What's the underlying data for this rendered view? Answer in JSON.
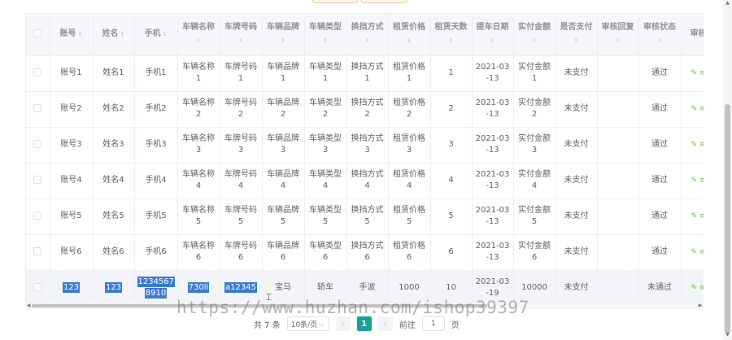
{
  "table": {
    "headers": {
      "account": "账号",
      "name": "姓名",
      "phone": "手机",
      "vehicle_name": "车辆名称",
      "plate": "车牌号码",
      "brand": "车辆品牌",
      "vehicle_type": "车辆类型",
      "gear": "换挡方式",
      "price": "租赁价格",
      "days": "租赁天数",
      "pickup_date": "提车日期",
      "paid_amount": "实付金额",
      "is_paid": "是否支付",
      "review_reply": "审核回复",
      "review_status": "审核状态",
      "review_op": "审核"
    },
    "rows": [
      {
        "account": "账号1",
        "name": "姓名1",
        "phone": "手机1",
        "vehicle_name": [
          "车辆名称",
          "1"
        ],
        "plate": [
          "车牌号码",
          "1"
        ],
        "brand": [
          "车辆品牌",
          "1"
        ],
        "vehicle_type": [
          "车辆类型",
          "1"
        ],
        "gear": [
          "换挡方式",
          "1"
        ],
        "price": [
          "租赁价格",
          "1"
        ],
        "days": "1",
        "pickup_date": [
          "2021-03",
          "-13"
        ],
        "paid_amount": [
          "实付金额",
          "1"
        ],
        "is_paid": "未支付",
        "review_reply": "",
        "review_status": "通过"
      },
      {
        "account": "账号2",
        "name": "姓名2",
        "phone": "手机2",
        "vehicle_name": [
          "车辆名称",
          "2"
        ],
        "plate": [
          "车牌号码",
          "2"
        ],
        "brand": [
          "车辆品牌",
          "2"
        ],
        "vehicle_type": [
          "车辆类型",
          "2"
        ],
        "gear": [
          "换挡方式",
          "2"
        ],
        "price": [
          "租赁价格",
          "2"
        ],
        "days": "2",
        "pickup_date": [
          "2021-03",
          "-13"
        ],
        "paid_amount": [
          "实付金额",
          "2"
        ],
        "is_paid": "未支付",
        "review_reply": "",
        "review_status": "通过"
      },
      {
        "account": "账号3",
        "name": "姓名3",
        "phone": "手机3",
        "vehicle_name": [
          "车辆名称",
          "3"
        ],
        "plate": [
          "车牌号码",
          "3"
        ],
        "brand": [
          "车辆品牌",
          "3"
        ],
        "vehicle_type": [
          "车辆类型",
          "3"
        ],
        "gear": [
          "换挡方式",
          "3"
        ],
        "price": [
          "租赁价格",
          "3"
        ],
        "days": "3",
        "pickup_date": [
          "2021-03",
          "-13"
        ],
        "paid_amount": [
          "实付金额",
          "3"
        ],
        "is_paid": "未支付",
        "review_reply": "",
        "review_status": "通过"
      },
      {
        "account": "账号4",
        "name": "姓名4",
        "phone": "手机4",
        "vehicle_name": [
          "车辆名称",
          "4"
        ],
        "plate": [
          "车牌号码",
          "4"
        ],
        "brand": [
          "车辆品牌",
          "4"
        ],
        "vehicle_type": [
          "车辆类型",
          "4"
        ],
        "gear": [
          "换挡方式",
          "4"
        ],
        "price": [
          "租赁价格",
          "4"
        ],
        "days": "4",
        "pickup_date": [
          "2021-03",
          "-13"
        ],
        "paid_amount": [
          "实付金额",
          "4"
        ],
        "is_paid": "未支付",
        "review_reply": "",
        "review_status": "通过"
      },
      {
        "account": "账号5",
        "name": "姓名5",
        "phone": "手机5",
        "vehicle_name": [
          "车辆名称",
          "5"
        ],
        "plate": [
          "车牌号码",
          "5"
        ],
        "brand": [
          "车辆品牌",
          "5"
        ],
        "vehicle_type": [
          "车辆类型",
          "5"
        ],
        "gear": [
          "换挡方式",
          "5"
        ],
        "price": [
          "租赁价格",
          "5"
        ],
        "days": "5",
        "pickup_date": [
          "2021-03",
          "-13"
        ],
        "paid_amount": [
          "实付金额",
          "5"
        ],
        "is_paid": "未支付",
        "review_reply": "",
        "review_status": "通过"
      },
      {
        "account": "账号6",
        "name": "姓名6",
        "phone": "手机6",
        "vehicle_name": [
          "车辆名称",
          "6"
        ],
        "plate": [
          "车牌号码",
          "6"
        ],
        "brand": [
          "车辆品牌",
          "6"
        ],
        "vehicle_type": [
          "车辆类型",
          "6"
        ],
        "gear": [
          "换挡方式",
          "6"
        ],
        "price": [
          "租赁价格",
          "6"
        ],
        "days": "6",
        "pickup_date": [
          "2021-03",
          "-13"
        ],
        "paid_amount": [
          "实付金额",
          "6"
        ],
        "is_paid": "未支付",
        "review_reply": "",
        "review_status": "通过"
      }
    ],
    "last_row": {
      "account": "123",
      "name": "123",
      "phone": [
        "1234567",
        "8910"
      ],
      "vehicle_name": "730li",
      "plate": "a12345",
      "brand": "宝马",
      "vehicle_type": "轿车",
      "gear": "手波",
      "price": "1000",
      "days": "10",
      "pickup_date": [
        "2021-03",
        "-19"
      ],
      "paid_amount": "10000",
      "is_paid": "未支付",
      "review_reply": "",
      "review_status": "未通过"
    },
    "op_icon": "edit-icon",
    "highlight_color": "#3a7bd5",
    "op_color": "#67c23a"
  },
  "pagination": {
    "total": "共 7 条",
    "page_size": "10条/页",
    "prev": "‹",
    "current_page": "1",
    "next": "›",
    "goto_label": "前往",
    "goto_value": "1",
    "goto_suffix": "页",
    "active_color": "#1aa094"
  },
  "watermark": "https://www.huzhan.com/ishop39397"
}
